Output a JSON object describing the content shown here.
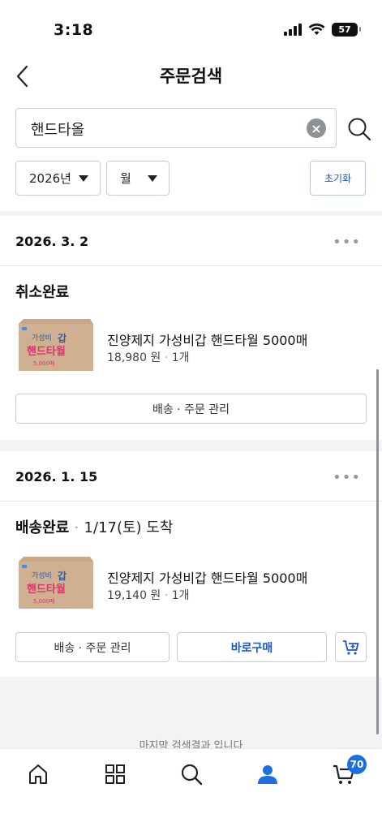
{
  "status_bar": {
    "time": "3:18",
    "battery": "57"
  },
  "nav": {
    "title": "주문검색"
  },
  "search": {
    "value": "핸드타올"
  },
  "filters": {
    "year": "2026년",
    "month": "월",
    "reset_label": "초기화"
  },
  "orders": [
    {
      "date": "2026. 3. 2",
      "status": "취소완료",
      "separator": "",
      "eta": "",
      "product_name": "진양제지 가성비갑 핸드타월 5000매",
      "price": "18,980 원",
      "quantity": "1개",
      "manage_label": "배송 · 주문 관리"
    },
    {
      "date": "2026. 1. 15",
      "status": "배송완료",
      "separator": "·",
      "eta": "1/17(토) 도착",
      "product_name": "진양제지 가성비갑 핸드타월 5000매",
      "price": "19,140 원",
      "quantity": "1개",
      "manage_label": "배송 · 주문 관리",
      "buy_again_label": "바로구매"
    }
  ],
  "thumbnail": {
    "line1": "가성비",
    "brand": "갑",
    "line2": "핸드타월",
    "count": "5,000매"
  },
  "footer_note": "마지막 검색결과 입니다",
  "tabbar": {
    "cart_count": "70"
  },
  "colors": {
    "accent": "#1a56c9",
    "badge": "#1d6fe0",
    "thumb_box": "#c9a887"
  }
}
